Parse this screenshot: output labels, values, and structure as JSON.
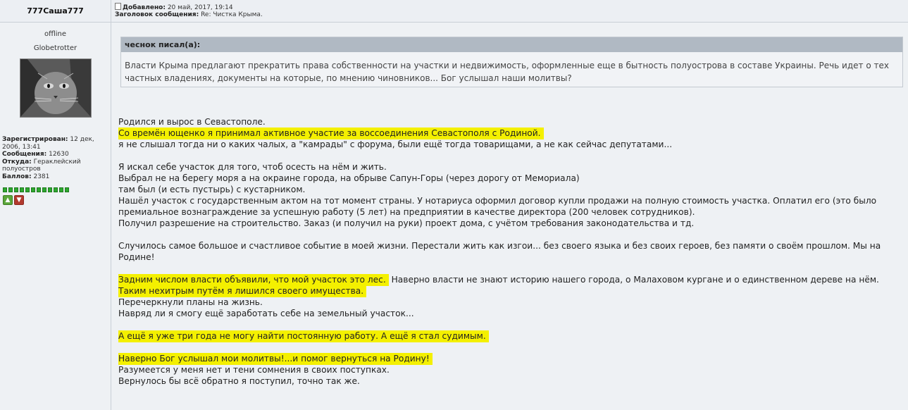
{
  "author": {
    "username": "777Саша777",
    "status": "offline",
    "rank": "Globetrotter",
    "registered_label": "Зарегистрирован:",
    "registered_value": "12 дек, 2006, 13:41",
    "messages_label": "Сообщения:",
    "messages_value": "12630",
    "from_label": "Откуда:",
    "from_value": "Гераклейский полуостров",
    "points_label": "Баллов:",
    "points_value": "2381",
    "rep_squares": 12
  },
  "meta": {
    "added_label": "Добавлено:",
    "added_value": "20 май, 2017, 19:14",
    "subject_label": "Заголовок сообщения:",
    "subject_value": "Re: Чистка Крыма."
  },
  "quote": {
    "header": "чеснок писал(а):",
    "text": "Власти Крыма предлагают прекратить права собственности на участки и недвижимость, оформленные еще в бытность полуострова в составе Украины. Речь идет о тех частных владениях, документы на которые, по мнению чиновников... Бог услышал наши молитвы?"
  },
  "post": {
    "l1": "Родился и вырос в Севастополе.",
    "l2": "Со времён ющенко я принимал активное участие за воссоединения Севастополя с Родиной.",
    "l3": "я не слышал тогда ни о каких чалых, а \"камрады\" с форума, были ещё тогда товарищами, а не как сейчас депутатами...",
    "l4": "Я искал себе участок для того, чтоб осесть на нём и жить.",
    "l5": "Выбрал не на берегу моря а на окраине города, на обрыве Сапун-Горы (через дорогу от Мемориала)",
    "l6": "там был (и есть пустырь) с кустарником.",
    "l7": "Нашёл участок с государственным актом на тот момент страны. У нотариуса оформил договор купли продажи на полную стоимость участка. Оплатил его (это было премиальное вознаграждение за успешную работу (5 лет) на предприятии в качестве директора (200 человек сотрудников).",
    "l8": "Получил разрешение на строительство. Заказ (и получил на руки) проект дома, с учётом требования законодательства и тд.",
    "l9": "Случилось самое большое и счастливое событие в моей жизни. Перестали жить как изгои... без своего языка и без своих героев, без памяти о своём прошлом. Мы на Родине!",
    "l10a": "Задним числом власти объявили, что мой участок это лес.",
    "l10b": " Наверно власти не знают историю нашего города, о Малаховом кургане и о единственном дереве на нём.",
    "l11": "Таким нехитрым путём я лишился своего имущества.",
    "l12": "Перечеркнули планы на жизнь.",
    "l13": "Навряд ли я смогу ещё заработать себе на земельный участок...",
    "l14": "А ещё я уже три года не могу найти постоянную работу. А ещё я стал судимым.",
    "l15": "Наверно Бог услышал мои молитвы!...и помог вернуться на Родину!",
    "l16": "Разумеется у меня нет и тени сомнения в своих поступках.",
    "l17": "Вернулось бы всё обратно я поступил, точно так же."
  },
  "colors": {
    "highlight": "#f4f000",
    "quote_header": "#b0b9c3",
    "background": "#eef1f4"
  },
  "icons": {
    "vote_up": "thumbs-up-icon",
    "vote_down": "thumbs-down-icon",
    "post": "post-icon"
  }
}
